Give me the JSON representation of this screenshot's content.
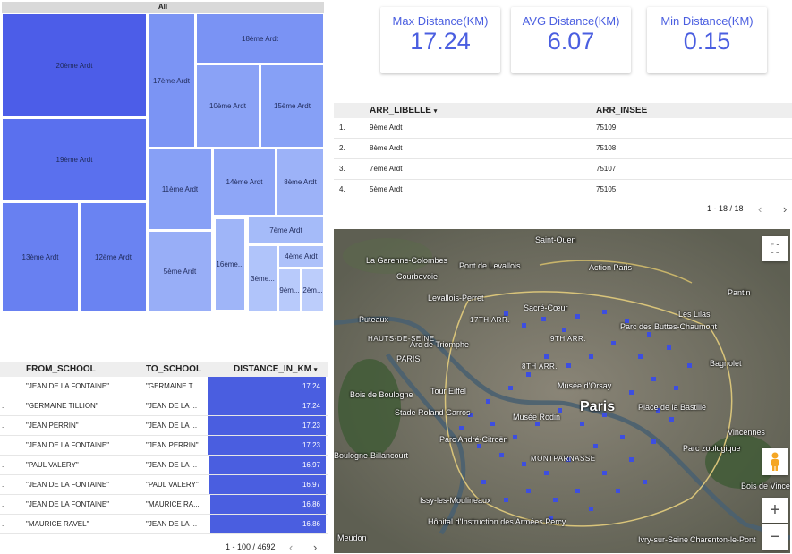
{
  "treemap": {
    "header": "All",
    "cells": [
      {
        "label": "20ème Ardt",
        "color": "#4c5de8"
      },
      {
        "label": "19ème Ardt",
        "color": "#5a70ee"
      },
      {
        "label": "13ème Ardt",
        "color": "#6880f1"
      },
      {
        "label": "12ème Ardt",
        "color": "#6a83f2"
      },
      {
        "label": "17ème Ardt",
        "color": "#7b94f4"
      },
      {
        "label": "18ème Ardt",
        "color": "#7a93f4"
      },
      {
        "label": "10ème Ardt",
        "color": "#8aa2f6"
      },
      {
        "label": "15ème Ardt",
        "color": "#86a0f6"
      },
      {
        "label": "11ème Ardt",
        "color": "#87a0f6"
      },
      {
        "label": "14ème Ardt",
        "color": "#8ea6f7"
      },
      {
        "label": "8ème Ardt",
        "color": "#9cb2f8"
      },
      {
        "label": "5ème Ardt",
        "color": "#98aef7"
      },
      {
        "label": "16ème...",
        "color": "#9fb5f8"
      },
      {
        "label": "7ème Ardt",
        "color": "#a5bbf9"
      },
      {
        "label": "3ème...",
        "color": "#b0c4fa"
      },
      {
        "label": "4ème Ardt",
        "color": "#adc1fa"
      },
      {
        "label": "9èm...",
        "color": "#b8cafb"
      },
      {
        "label": "2èm...",
        "color": "#bccdfb"
      }
    ]
  },
  "kpis": [
    {
      "label": "Max Distance(KM)",
      "value": "17.24"
    },
    {
      "label": "AVG Distance(KM)",
      "value": "6.07"
    },
    {
      "label": "Min Distance(KM)",
      "value": "0.15"
    }
  ],
  "arr_table": {
    "columns": [
      "ARR_LIBELLE",
      "ARR_INSEE"
    ],
    "sort_icon": "▾",
    "rows": [
      {
        "num": "1.",
        "libelle": "9ème Ardt",
        "insee": "75109"
      },
      {
        "num": "2.",
        "libelle": "8ème Ardt",
        "insee": "75108"
      },
      {
        "num": "3.",
        "libelle": "7ème Ardt",
        "insee": "75107"
      },
      {
        "num": "4.",
        "libelle": "5ème Ardt",
        "insee": "75105"
      }
    ],
    "pager": "1 - 18 / 18"
  },
  "dist_table": {
    "columns": [
      "FROM_SCHOOL",
      "TO_SCHOOL",
      "DISTANCE_IN_KM"
    ],
    "sort_icon": "▾",
    "rows": [
      {
        "num": ".",
        "from": "\"JEAN DE LA FONTAINE\"",
        "to": "\"GERMAINE T...",
        "km": "17.24",
        "fraction": 1.0
      },
      {
        "num": ".",
        "from": "\"GERMAINE TILLION\"",
        "to": "\"JEAN DE LA ...",
        "km": "17.24",
        "fraction": 1.0
      },
      {
        "num": ".",
        "from": "\"JEAN PERRIN\"",
        "to": "\"JEAN DE LA ...",
        "km": "17.23",
        "fraction": 0.999
      },
      {
        "num": ".",
        "from": "\"JEAN DE LA FONTAINE\"",
        "to": "\"JEAN PERRIN\"",
        "km": "17.23",
        "fraction": 0.999
      },
      {
        "num": ".",
        "from": "\"PAUL VALERY\"",
        "to": "\"JEAN DE LA ...",
        "km": "16.97",
        "fraction": 0.984
      },
      {
        "num": ".",
        "from": "\"JEAN DE LA FONTAINE\"",
        "to": "\"PAUL VALERY\"",
        "km": "16.97",
        "fraction": 0.984
      },
      {
        "num": ".",
        "from": "\"JEAN DE LA FONTAINE\"",
        "to": "\"MAURICE RA...",
        "km": "16.86",
        "fraction": 0.978
      },
      {
        "num": ".",
        "from": "\"MAURICE RAVEL\"",
        "to": "\"JEAN DE LA ...",
        "km": "16.86",
        "fraction": 0.978
      }
    ],
    "pager": "1 - 100 / 4692"
  },
  "map": {
    "labels": [
      {
        "text": "Saint-Ouen",
        "type": "normal"
      },
      {
        "text": "La Garenne-Colombes",
        "type": "normal"
      },
      {
        "text": "Courbevoie",
        "type": "normal"
      },
      {
        "text": "Pont de Levallois",
        "type": "normal"
      },
      {
        "text": "Action Paris",
        "type": "normal"
      },
      {
        "text": "Levallois-Perret",
        "type": "normal"
      },
      {
        "text": "Sacré-Cœur",
        "type": "normal"
      },
      {
        "text": "Pantin",
        "type": "normal"
      },
      {
        "text": "Puteaux",
        "type": "normal"
      },
      {
        "text": "17TH ARR.",
        "type": "arr"
      },
      {
        "text": "Les Lilas",
        "type": "normal"
      },
      {
        "text": "HAUTS-DE-SEINE",
        "type": "arr"
      },
      {
        "text": "Arc de Triomphe",
        "type": "normal"
      },
      {
        "text": "9TH ARR.",
        "type": "arr"
      },
      {
        "text": "Parc des Buttes-Chaumont",
        "type": "normal"
      },
      {
        "text": "PARIS",
        "type": "normal"
      },
      {
        "text": "8TH ARR.",
        "type": "arr"
      },
      {
        "text": "Bagnolet",
        "type": "normal"
      },
      {
        "text": "Tour Eiffel",
        "type": "normal"
      },
      {
        "text": "Musée d'Orsay",
        "type": "normal"
      },
      {
        "text": "Paris",
        "type": "big"
      },
      {
        "text": "Place de la Bastille",
        "type": "normal"
      },
      {
        "text": "Bois de Boulogne",
        "type": "normal"
      },
      {
        "text": "Stade Roland Garros",
        "type": "normal"
      },
      {
        "text": "Musée Rodin",
        "type": "normal"
      },
      {
        "text": "Vincennes",
        "type": "normal"
      },
      {
        "text": "Parc André-Citroën",
        "type": "normal"
      },
      {
        "text": "Boulogne-Billancourt",
        "type": "normal"
      },
      {
        "text": "MONTPARNASSE",
        "type": "arr"
      },
      {
        "text": "Parc zoologique",
        "type": "normal"
      },
      {
        "text": "Bois de Vincennes",
        "type": "normal"
      },
      {
        "text": "Issy-les-Moulineaux",
        "type": "normal"
      },
      {
        "text": "Charenton-le-Pont",
        "type": "normal"
      },
      {
        "text": "Hôpital d'Instruction des Armées Percy",
        "type": "normal"
      },
      {
        "text": "Meudon",
        "type": "normal"
      },
      {
        "text": "Ivry-sur-Seine",
        "type": "normal"
      }
    ],
    "zoom_in": "+",
    "zoom_out": "−"
  }
}
